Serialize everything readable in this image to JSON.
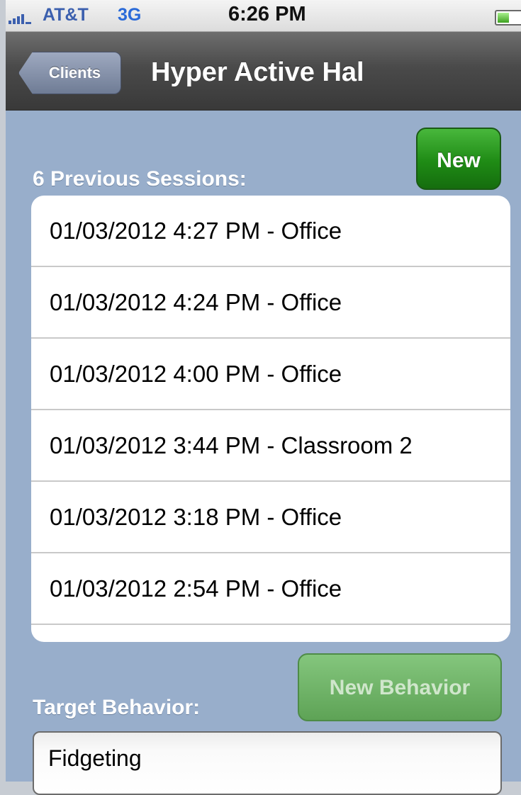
{
  "status_bar": {
    "carrier": "AT&T",
    "network": "3G",
    "time": "6:26 PM",
    "battery_level": 0.45,
    "signal_bars": 5
  },
  "nav": {
    "back_label": "Clients",
    "title": "Hyper Active Hal"
  },
  "sessions": {
    "new_label": "New",
    "header": "6 Previous Sessions:",
    "items": [
      "01/03/2012 4:27 PM - Office",
      "01/03/2012 4:24 PM - Office",
      "01/03/2012 4:00 PM - Office",
      "01/03/2012 3:44 PM - Classroom 2",
      "01/03/2012 3:18 PM - Office",
      "01/03/2012 2:54 PM - Office"
    ]
  },
  "behavior": {
    "new_label": "New Behavior",
    "label": "Target Behavior:",
    "value": "Fidgeting"
  },
  "colors": {
    "content_bg": "#98aecb",
    "new_button": "#1f8b15",
    "new_behavior_button_disabled": "#6eb366",
    "nav_bg": "#4a4a4a",
    "back_button": "#7d89a3"
  }
}
